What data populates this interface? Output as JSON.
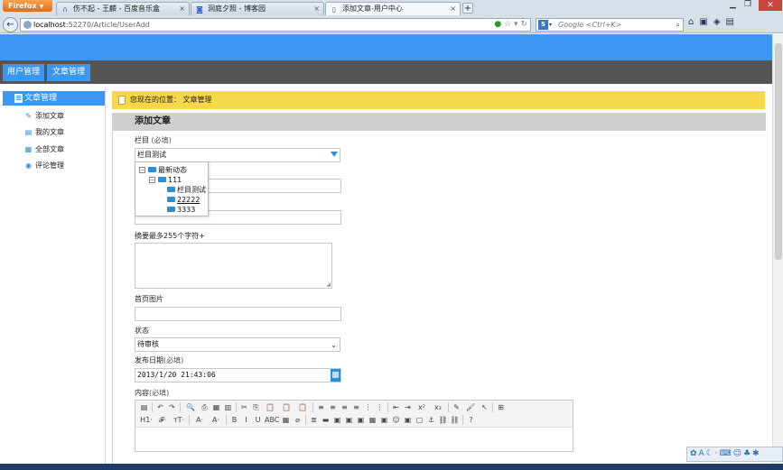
{
  "browser": {
    "menu_label": "Firefox",
    "tabs": [
      {
        "title": "伤不起 - 王麟 - 百度音乐盒",
        "icon": "headphones-icon"
      },
      {
        "title": "洞庭夕照 - 博客园",
        "icon": "page-icon"
      },
      {
        "title": "添加文章-用户中心",
        "icon": "page-icon"
      }
    ],
    "new_tab": "+",
    "url_host": "localhost",
    "url_path": ":52270/Article/UserAdd",
    "search_engine": "S",
    "search_placeholder": "Google <Ctrl+K>"
  },
  "app_nav": {
    "items": [
      {
        "label": "用户管理"
      },
      {
        "label": "文章管理"
      }
    ]
  },
  "sidebar": {
    "header": "文章管理",
    "items": [
      {
        "label": "添加文章",
        "icon": "pen-icon"
      },
      {
        "label": "我的文章",
        "icon": "doc-icon"
      },
      {
        "label": "全部文章",
        "icon": "list-icon"
      },
      {
        "label": "评论管理",
        "icon": "comment-icon"
      }
    ]
  },
  "breadcrumb": {
    "prefix": "您现在的位置：",
    "current": "文章管理"
  },
  "panel": {
    "title": "添加文章"
  },
  "form": {
    "category_label": "栏目",
    "category_req": "(必填)",
    "category_value": "栏目测试",
    "tree": {
      "root": "最新动态",
      "child": "111",
      "leaves": [
        "栏目测试",
        "22222",
        "3333"
      ]
    },
    "summary_label": "摘要最多255个字符+",
    "image_label": "首页图片",
    "status_label": "状态",
    "status_value": "待审核",
    "date_label": "发布日期",
    "date_req": "(必填)",
    "date_value": "2013/1/20 21:43:06",
    "content_label": "内容",
    "content_req": "(必填)"
  },
  "editor": {
    "row1": [
      "▤",
      "↶",
      "↷",
      "🔍",
      "⎙",
      "▦",
      "▥",
      "✂",
      "⎘",
      "📋",
      "📋",
      "📋",
      "≡",
      "≡",
      "≡",
      "≡",
      "⋮",
      "⋮",
      "⇤",
      "⇥",
      "x²",
      "x₂",
      "✎",
      "🖌",
      "↖",
      "⊞"
    ],
    "row2": [
      "H1·",
      "𝓕·",
      "тT·",
      "A·",
      "A·",
      "B",
      "I",
      "U",
      "ABC",
      "▦",
      "⌀",
      "≣",
      "▬",
      "▣",
      "▣",
      "▣",
      "▦",
      "▣",
      "☺",
      "▣",
      "▢",
      "⚓",
      "⛓",
      "⛓",
      "?"
    ]
  }
}
